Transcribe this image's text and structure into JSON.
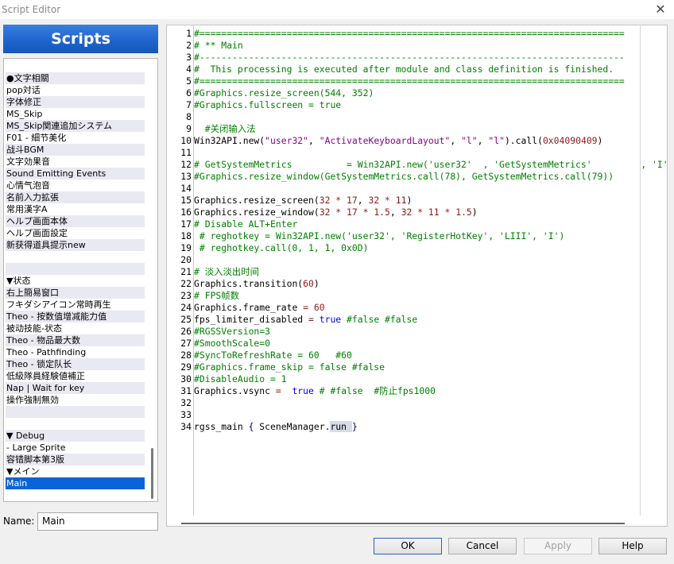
{
  "window": {
    "title": "Script Editor",
    "close_glyph": "✕"
  },
  "sidebar": {
    "header": "Scripts",
    "items": [
      {
        "label": "",
        "alt": false
      },
      {
        "label": "●文字相關",
        "alt": true
      },
      {
        "label": "pop対话",
        "alt": false
      },
      {
        "label": "字体修正",
        "alt": true
      },
      {
        "label": "MS_Skip",
        "alt": false
      },
      {
        "label": "MS_Skip関連追加システム",
        "alt": true
      },
      {
        "label": "F01 - 細节美化",
        "alt": false
      },
      {
        "label": "战斗BGM",
        "alt": true
      },
      {
        "label": "文字効果音",
        "alt": false
      },
      {
        "label": "Sound Emitting Events",
        "alt": true
      },
      {
        "label": "心情气泡音",
        "alt": false
      },
      {
        "label": "名前入力拡張",
        "alt": true
      },
      {
        "label": "常用漢字A",
        "alt": false
      },
      {
        "label": "ヘルプ画面本体",
        "alt": true
      },
      {
        "label": "ヘルプ画面設定",
        "alt": false
      },
      {
        "label": "新获得道具提示new",
        "alt": true
      },
      {
        "label": "",
        "alt": false
      },
      {
        "label": "",
        "alt": true
      },
      {
        "label": "▼状态",
        "alt": false
      },
      {
        "label": "右上簡易窗口",
        "alt": true
      },
      {
        "label": "フキダシアイコン常時再生",
        "alt": false
      },
      {
        "label": "Theo - 按数值增减能力值",
        "alt": true
      },
      {
        "label": "被动技能-状态",
        "alt": false
      },
      {
        "label": "Theo - 物品最大数",
        "alt": true
      },
      {
        "label": "Theo - Pathfinding",
        "alt": false
      },
      {
        "label": "Theo - 锁定队长",
        "alt": true
      },
      {
        "label": "低級隊員経験値補正",
        "alt": false
      },
      {
        "label": "Nap | Wait for key",
        "alt": true
      },
      {
        "label": "操作強制無効",
        "alt": false
      },
      {
        "label": "",
        "alt": true
      },
      {
        "label": "",
        "alt": false
      },
      {
        "label": "▼ Debug",
        "alt": true
      },
      {
        "label": "- Large Sprite",
        "alt": false
      },
      {
        "label": "容错脚本第3版",
        "alt": true
      },
      {
        "label": "▼メイン",
        "alt": false
      },
      {
        "label": "Main",
        "alt": false,
        "selected": true
      }
    ]
  },
  "name_field": {
    "label": "Name:",
    "value": "Main"
  },
  "editor": {
    "lines": [
      {
        "n": "1",
        "t": [
          [
            "c",
            "#=============================================================================="
          ]
        ]
      },
      {
        "n": "2",
        "t": [
          [
            "c",
            "# ** Main"
          ]
        ]
      },
      {
        "n": "3",
        "t": [
          [
            "c",
            "#------------------------------------------------------------------------------"
          ]
        ]
      },
      {
        "n": "4",
        "t": [
          [
            "c",
            "#  This processing is executed after module and class definition is finished."
          ]
        ]
      },
      {
        "n": "5",
        "t": [
          [
            "c",
            "#=============================================================================="
          ]
        ]
      },
      {
        "n": "6",
        "t": [
          [
            "c",
            "#Graphics.resize_screen(544, 352)"
          ]
        ]
      },
      {
        "n": "7",
        "t": [
          [
            "c",
            "#Graphics.fullscreen = true"
          ]
        ]
      },
      {
        "n": "8",
        "t": []
      },
      {
        "n": "9",
        "t": [
          [
            "c",
            "  #关闭输入法"
          ]
        ]
      },
      {
        "n": "10",
        "t": [
          [
            "",
            "Win32API.new("
          ],
          [
            "s",
            "\"user32\""
          ],
          [
            "",
            ", "
          ],
          [
            "s",
            "\"ActivateKeyboardLayout\""
          ],
          [
            "",
            ", "
          ],
          [
            "s",
            "\"l\""
          ],
          [
            "",
            ", "
          ],
          [
            "s",
            "\"l\""
          ],
          [
            "",
            ").call("
          ],
          [
            "n",
            "0x04090409"
          ],
          [
            "",
            ")"
          ]
        ]
      },
      {
        "n": "11",
        "t": []
      },
      {
        "n": "12",
        "t": [
          [
            "c",
            "# GetSystemMetrics          = Win32API.new('user32'  , 'GetSystemMetrics'         , 'I'"
          ]
        ]
      },
      {
        "n": "13",
        "t": [
          [
            "c",
            "#Graphics.resize_window(GetSystemMetrics.call(78), GetSystemMetrics.call(79))"
          ]
        ]
      },
      {
        "n": "14",
        "t": []
      },
      {
        "n": "15",
        "t": [
          [
            "",
            "Graphics.resize_screen("
          ],
          [
            "n",
            "32"
          ],
          [
            "o",
            " * "
          ],
          [
            "n",
            "17"
          ],
          [
            "",
            ", "
          ],
          [
            "n",
            "32"
          ],
          [
            "o",
            " * "
          ],
          [
            "n",
            "11"
          ],
          [
            "",
            ")"
          ]
        ]
      },
      {
        "n": "16",
        "t": [
          [
            "",
            "Graphics.resize_window("
          ],
          [
            "n",
            "32"
          ],
          [
            "o",
            " * "
          ],
          [
            "n",
            "17"
          ],
          [
            "o",
            " * "
          ],
          [
            "n",
            "1.5"
          ],
          [
            "",
            ", "
          ],
          [
            "n",
            "32"
          ],
          [
            "o",
            " * "
          ],
          [
            "n",
            "11"
          ],
          [
            "o",
            " * "
          ],
          [
            "n",
            "1.5"
          ],
          [
            "",
            ")"
          ]
        ]
      },
      {
        "n": "17",
        "t": [
          [
            "c",
            "# Disable ALT+Enter"
          ]
        ]
      },
      {
        "n": "18",
        "t": [
          [
            "c",
            " # reghotkey = Win32API.new('user32', 'RegisterHotKey', 'LIII', 'I')"
          ]
        ]
      },
      {
        "n": "19",
        "t": [
          [
            "c",
            " # reghotkey.call(0, 1, 1, 0x0D)"
          ]
        ]
      },
      {
        "n": "20",
        "t": []
      },
      {
        "n": "21",
        "t": [
          [
            "c",
            "# 淡入淡出时间"
          ]
        ]
      },
      {
        "n": "22",
        "t": [
          [
            "",
            "Graphics.transition("
          ],
          [
            "n",
            "60"
          ],
          [
            "",
            ")"
          ]
        ]
      },
      {
        "n": "23",
        "t": [
          [
            "c",
            "# FPS帧数"
          ]
        ]
      },
      {
        "n": "24",
        "t": [
          [
            "",
            "Graphics.frame_rate "
          ],
          [
            "o",
            "="
          ],
          [
            "",
            " "
          ],
          [
            "n",
            "60"
          ]
        ]
      },
      {
        "n": "25",
        "t": [
          [
            "",
            "fps_limiter_disabled "
          ],
          [
            "o",
            "="
          ],
          [
            "",
            " "
          ],
          [
            "k",
            "true"
          ],
          [
            "",
            " "
          ],
          [
            "c",
            "#false #false"
          ]
        ]
      },
      {
        "n": "26",
        "t": [
          [
            "c",
            "#RGSSVersion=3"
          ]
        ]
      },
      {
        "n": "27",
        "t": [
          [
            "c",
            "#SmoothScale=0"
          ]
        ]
      },
      {
        "n": "28",
        "t": [
          [
            "c",
            "#SyncToRefreshRate = 60   #60"
          ]
        ]
      },
      {
        "n": "29",
        "t": [
          [
            "c",
            "#Graphics.frame_skip = false #false"
          ]
        ]
      },
      {
        "n": "30",
        "t": [
          [
            "c",
            "#DisableAudio = 1"
          ]
        ]
      },
      {
        "n": "31",
        "t": [
          [
            "",
            "Graphics.vsync "
          ],
          [
            "o",
            "="
          ],
          [
            "",
            "  "
          ],
          [
            "k",
            "true"
          ],
          [
            "",
            " "
          ],
          [
            "c",
            "# #false  #防止fps1000"
          ]
        ]
      },
      {
        "n": "32",
        "t": []
      },
      {
        "n": "33",
        "t": []
      },
      {
        "n": "34",
        "t": [
          [
            "",
            "rgss_main "
          ],
          [
            "p",
            "{"
          ],
          [
            "",
            " SceneManager."
          ],
          [
            "hl",
            "run "
          ],
          [
            "p",
            "}"
          ]
        ]
      }
    ]
  },
  "buttons": {
    "ok": "OK",
    "cancel": "Cancel",
    "apply": "Apply",
    "help": "Help"
  }
}
